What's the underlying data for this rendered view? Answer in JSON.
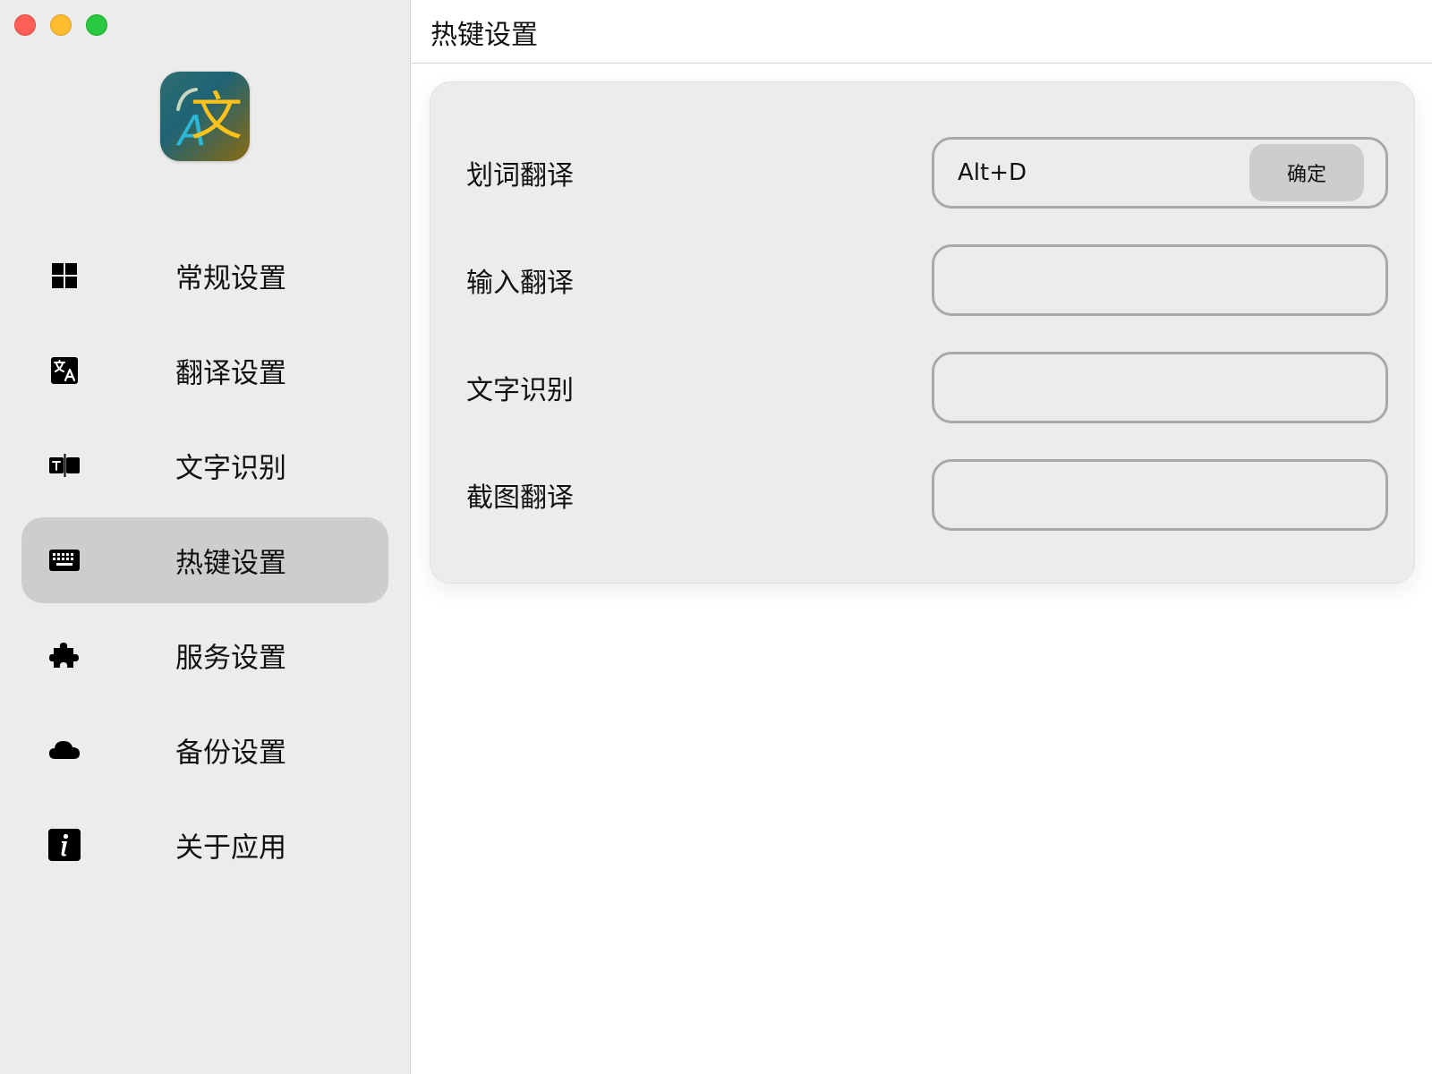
{
  "sidebar": {
    "items": [
      {
        "label": "常规设置",
        "icon": "grid-icon",
        "active": false
      },
      {
        "label": "翻译设置",
        "icon": "translate-icon",
        "active": false
      },
      {
        "label": "文字识别",
        "icon": "text-recognition-icon",
        "active": false
      },
      {
        "label": "热键设置",
        "icon": "keyboard-icon",
        "active": true
      },
      {
        "label": "服务设置",
        "icon": "puzzle-icon",
        "active": false
      },
      {
        "label": "备份设置",
        "icon": "cloud-icon",
        "active": false
      },
      {
        "label": "关于应用",
        "icon": "info-icon",
        "active": false
      }
    ]
  },
  "logo": {
    "latin_glyph": "A",
    "cjk_glyph": "文"
  },
  "header": {
    "title": "热键设置"
  },
  "hotkeys": [
    {
      "label": "划词翻译",
      "value": "Alt+D",
      "confirm_label": "确定"
    },
    {
      "label": "输入翻译",
      "value": ""
    },
    {
      "label": "文字识别",
      "value": ""
    },
    {
      "label": "截图翻译",
      "value": ""
    }
  ],
  "colors": {
    "sidebar_bg": "#ececec",
    "active_item_bg": "#cdcdcd",
    "card_bg": "#ececec",
    "input_border": "#a8a8a8",
    "traffic_close": "#ff5f57",
    "traffic_min": "#febc2e",
    "traffic_max": "#28c840"
  }
}
